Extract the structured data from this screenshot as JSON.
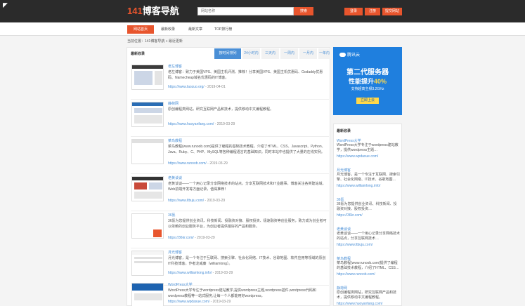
{
  "header": {
    "logo_number": "141",
    "logo_text": "博客导航",
    "search_placeholder": "网站名称",
    "search_button": "搜索",
    "buttons": [
      "登录",
      "注册",
      "提交网站"
    ]
  },
  "nav": {
    "items": [
      "网站首页",
      "最新收录",
      "最新文章",
      "TOP排行榜"
    ]
  },
  "breadcrumb": "当前位置：141博客导航 » 最近更新",
  "main": {
    "title": "最新收录",
    "tabs": [
      "按时间排列",
      "24小时内",
      "三天内",
      "一周内",
      "一月内",
      "一年内"
    ],
    "items": [
      {
        "title": "老左博客",
        "desc": "老左博客：致力于美国VPS、美国主机评测、推荐！分享美国VPS、美国主机优惠码、Godaddy优惠码、Namecheap域名优惠码的IT博客。",
        "url": "https://www.laozuo.org/",
        "date": "2019-04-01"
      },
      {
        "title": "静荷网",
        "desc": "原创编程类网站，研究互联网产品和技术，提供移动中文编程教程。",
        "url": "https://www.huoyanfang.com/",
        "date": "2019-03-29"
      },
      {
        "title": "菜鸟教程",
        "desc": "菜鸟教程(www.runoob.com)提供了编程的基础技术教程，介绍了HTML、CSS、Javascript、Python、Java、Ruby、C、PHP、MySQL等各种编程语言的基础知识。同时本站中也提供了大量的在线实例。",
        "url": "https://www.runoob.com/",
        "date": "2019-03-29"
      },
      {
        "title": "老黄谈谈",
        "desc": "老黄谈谈——一个用心记录分享网络技术的站点，分享互联网技术和IT业趣事，博客关注各类建站域，Web前端开发等方面记录，值得推荐！",
        "url": "https://www.ltbuju.com/",
        "date": "2019-03-29"
      },
      {
        "title": "36氪",
        "desc": "36氪为您提供创业资讯、科技新闻、投融资对接、股权投资、极速融资等创业服务，致力成为创业者可以依赖的创业服务平台，为创业者提供最好的产品和服务。",
        "url": "https://36kr.com/",
        "date": "2019-03-29"
      },
      {
        "title": "月光博客",
        "desc": "月光博客，是一个专注于互联网、搜索引擎、社会化网络、IT技术、谷歌地图、软件应用等领域的原创IT科技博客，作者龙威廉（williamlong）。",
        "url": "https://www.williamlong.info/",
        "date": "2019-03-29"
      },
      {
        "title": "WordPress大学",
        "desc": "WordPress大学专注于wordpress建站教学,提供wordpress主题,wordpress插件,wordpress代码和wordpress教程等一站式服务,让每一个人都能用好wordpress。",
        "url": "https://www.wpdaxue.com/",
        "date": "2019-03-29"
      }
    ]
  },
  "ad": {
    "brand": "腾讯云",
    "line1": "第二代服务器",
    "line2_prefix": "性能提升",
    "line2_highlight": "40%",
    "line3": "支持超高主频3.2GHz",
    "button": "立即上云"
  },
  "sidebar": {
    "title": "最新收录",
    "items": [
      {
        "title": "WordPress大学",
        "desc": "WordPress大学专注于wordpress建站教学，提供wordpress主题…",
        "url": "https://www.wpdaxue.com/"
      },
      {
        "title": "月光博客",
        "desc": "月光博客，是一个专注于互联网、搜索引擎、社会化网络、IT技术、谷歌地图…",
        "url": "https://www.williamlong.info/"
      },
      {
        "title": "36氪",
        "desc": "36氪为您提供创业资讯、科技新闻、投融资对接、股权投资…",
        "url": "https://36kr.com/"
      },
      {
        "title": "老黄谈谈",
        "desc": "老黄谈谈——一个用心记录分享网络技术的站点，分享互联网技术…",
        "url": "https://www.ltbuju.com/"
      },
      {
        "title": "菜鸟教程",
        "desc": "菜鸟教程(www.runoob.com)提供了编程的基础技术教程，介绍了HTML、CSS…",
        "url": "https://www.runoob.com/"
      },
      {
        "title": "静荷网",
        "desc": "原创编程类网站，研究互联网产品和技术，提供移动中文编程教程。",
        "url": "https://www.huoyanfang.com/"
      }
    ]
  },
  "colors": {
    "accent": "#e8552d",
    "link": "#4a8fd6",
    "topbar": "#2b2b2b",
    "ad_bg": "#1f7fde"
  }
}
